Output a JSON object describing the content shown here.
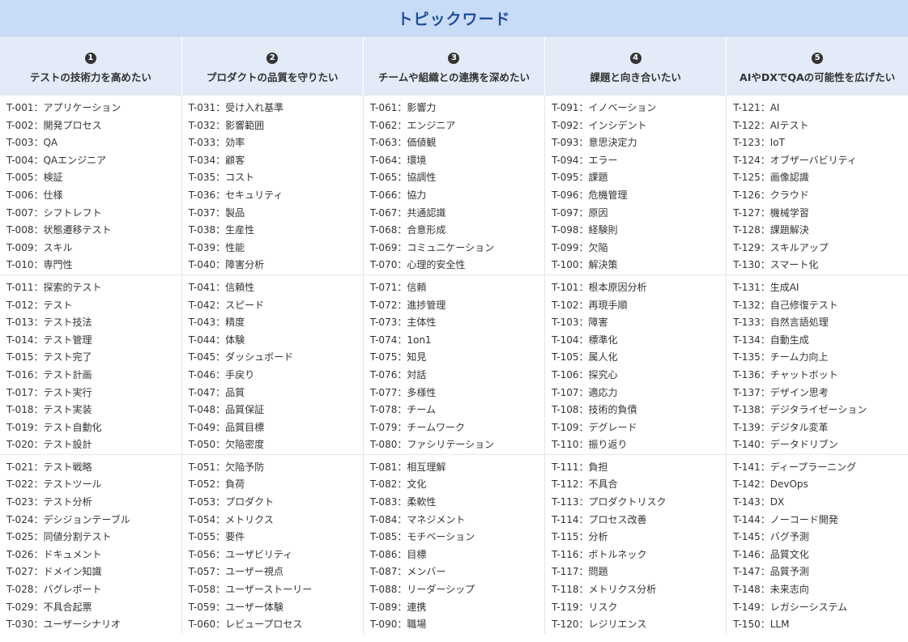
{
  "title": "トピックワード",
  "columns": [
    {
      "number": "1",
      "title": "テストの技術力を高めたい"
    },
    {
      "number": "2",
      "title": "プロダクトの品質を守りたい"
    },
    {
      "number": "3",
      "title": "チームや組織との連携を深めたい"
    },
    {
      "number": "4",
      "title": "課題と向き合いたい"
    },
    {
      "number": "5",
      "title": "AIやDXでQAの可能性を広げたい"
    }
  ],
  "rows": [
    [
      [
        "T-001：アプリケーション",
        "T-002：開発プロセス",
        "T-003：QA",
        "T-004：QAエンジニア",
        "T-005：検証",
        "T-006：仕様",
        "T-007：シフトレフト",
        "T-008：状態遷移テスト",
        "T-009：スキル",
        "T-010：専門性"
      ],
      [
        "T-031：受け入れ基準",
        "T-032：影響範囲",
        "T-033：効率",
        "T-034：顧客",
        "T-035：コスト",
        "T-036：セキュリティ",
        "T-037：製品",
        "T-038：生産性",
        "T-039：性能",
        "T-040：障害分析"
      ],
      [
        "T-061：影響力",
        "T-062：エンジニア",
        "T-063：価値観",
        "T-064：環境",
        "T-065：協調性",
        "T-066：協力",
        "T-067：共通認識",
        "T-068：合意形成",
        "T-069：コミュニケーション",
        "T-070：心理的安全性"
      ],
      [
        "T-091：イノベーション",
        "T-092：インシデント",
        "T-093：意思決定力",
        "T-094：エラー",
        "T-095：課題",
        "T-096：危機管理",
        "T-097：原因",
        "T-098：経験則",
        "T-099：欠陥",
        "T-100：解決策"
      ],
      [
        "T-121：AI",
        "T-122：AIテスト",
        "T-123：IoT",
        "T-124：オブザーバビリティ",
        "T-125：画像認識",
        "T-126：クラウド",
        "T-127：機械学習",
        "T-128：課題解決",
        "T-129：スキルアップ",
        "T-130：スマート化"
      ]
    ],
    [
      [
        "T-011：探索的テスト",
        "T-012：テスト",
        "T-013：テスト技法",
        "T-014：テスト管理",
        "T-015：テスト完了",
        "T-016：テスト計画",
        "T-017：テスト実行",
        "T-018：テスト実装",
        "T-019：テスト自動化",
        "T-020：テスト設計"
      ],
      [
        "T-041：信頼性",
        "T-042：スピード",
        "T-043：精度",
        "T-044：体験",
        "T-045：ダッシュボード",
        "T-046：手戻り",
        "T-047：品質",
        "T-048：品質保証",
        "T-049：品質目標",
        "T-050：欠陥密度"
      ],
      [
        "T-071：信頼",
        "T-072：進捗管理",
        "T-073：主体性",
        "T-074：1on1",
        "T-075：知見",
        "T-076：対話",
        "T-077：多様性",
        "T-078：チーム",
        "T-079：チームワーク",
        "T-080：ファシリテーション"
      ],
      [
        "T-101：根本原因分析",
        "T-102：再現手順",
        "T-103：障害",
        "T-104：標準化",
        "T-105：属人化",
        "T-106：探究心",
        "T-107：適応力",
        "T-108：技術的負債",
        "T-109：デグレード",
        "T-110：振り返り"
      ],
      [
        "T-131：生成AI",
        "T-132：自己修復テスト",
        "T-133：自然言語処理",
        "T-134：自動生成",
        "T-135：チーム力向上",
        "T-136：チャットボット",
        "T-137：デザイン思考",
        "T-138：デジタライゼーション",
        "T-139：デジタル変革",
        "T-140：データドリブン"
      ]
    ],
    [
      [
        "T-021：テスト戦略",
        "T-022：テストツール",
        "T-023：テスト分析",
        "T-024：デシジョンテーブル",
        "T-025：同値分割テスト",
        "T-026：ドキュメント",
        "T-027：ドメイン知識",
        "T-028：バグレポート",
        "T-029：不具合起票",
        "T-030：ユーザーシナリオ"
      ],
      [
        "T-051：欠陥予防",
        "T-052：負荷",
        "T-053：プロダクト",
        "T-054：メトリクス",
        "T-055：要件",
        "T-056：ユーザビリティ",
        "T-057：ユーザー視点",
        "T-058：ユーザーストーリー",
        "T-059：ユーザー体験",
        "T-060：レビュープロセス"
      ],
      [
        "T-081：相互理解",
        "T-082：文化",
        "T-083：柔軟性",
        "T-084：マネジメント",
        "T-085：モチベーション",
        "T-086：目標",
        "T-087：メンバー",
        "T-088：リーダーシップ",
        "T-089：連携",
        "T-090：職場"
      ],
      [
        "T-111：負担",
        "T-112：不具合",
        "T-113：プロダクトリスク",
        "T-114：プロセス改善",
        "T-115：分析",
        "T-116：ボトルネック",
        "T-117：問題",
        "T-118：メトリクス分析",
        "T-119：リスク",
        "T-120：レジリエンス"
      ],
      [
        "T-141：ディープラーニング",
        "T-142：DevOps",
        "T-143：DX",
        "T-144：ノーコード開発",
        "T-145：バグ予測",
        "T-146：品質文化",
        "T-147：品質予測",
        "T-148：未来志向",
        "T-149：レガシーシステム",
        "T-150：LLM"
      ]
    ]
  ]
}
